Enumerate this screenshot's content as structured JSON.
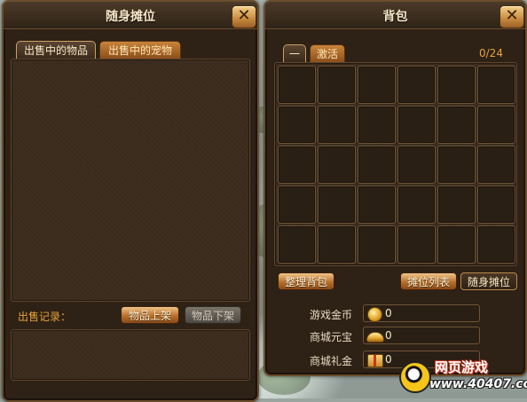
{
  "left_panel": {
    "title": "随身摊位",
    "tabs": [
      {
        "label": "出售中的物品",
        "active": true
      },
      {
        "label": "出售中的宠物",
        "active": false
      }
    ],
    "sales_record_label": "出售记录：",
    "buttons": {
      "list_item": "物品上架",
      "delist_item": "物品下架"
    }
  },
  "right_panel": {
    "title": "背包",
    "tabs": [
      {
        "label": "一",
        "active": true
      },
      {
        "label": "激活",
        "active": false
      }
    ],
    "capacity": "0/24",
    "buttons": {
      "organize": "整理背包",
      "stall_list": "摊位列表",
      "portable_stall": "随身摊位"
    },
    "currencies": [
      {
        "label": "游戏金币",
        "value": "0",
        "icon": "gold-coin-icon"
      },
      {
        "label": "商城元宝",
        "value": "0",
        "icon": "gold-ingot-icon"
      },
      {
        "label": "商城礼金",
        "value": "0",
        "icon": "gift-voucher-icon"
      }
    ]
  },
  "watermark": {
    "line1": "网页游戏",
    "line2": "www.40407.com"
  },
  "colors": {
    "panel_bg": "#2e2116",
    "border": "#6b4d2d",
    "accent_gold": "#e8a33a",
    "text_light": "#f6e8c7"
  }
}
